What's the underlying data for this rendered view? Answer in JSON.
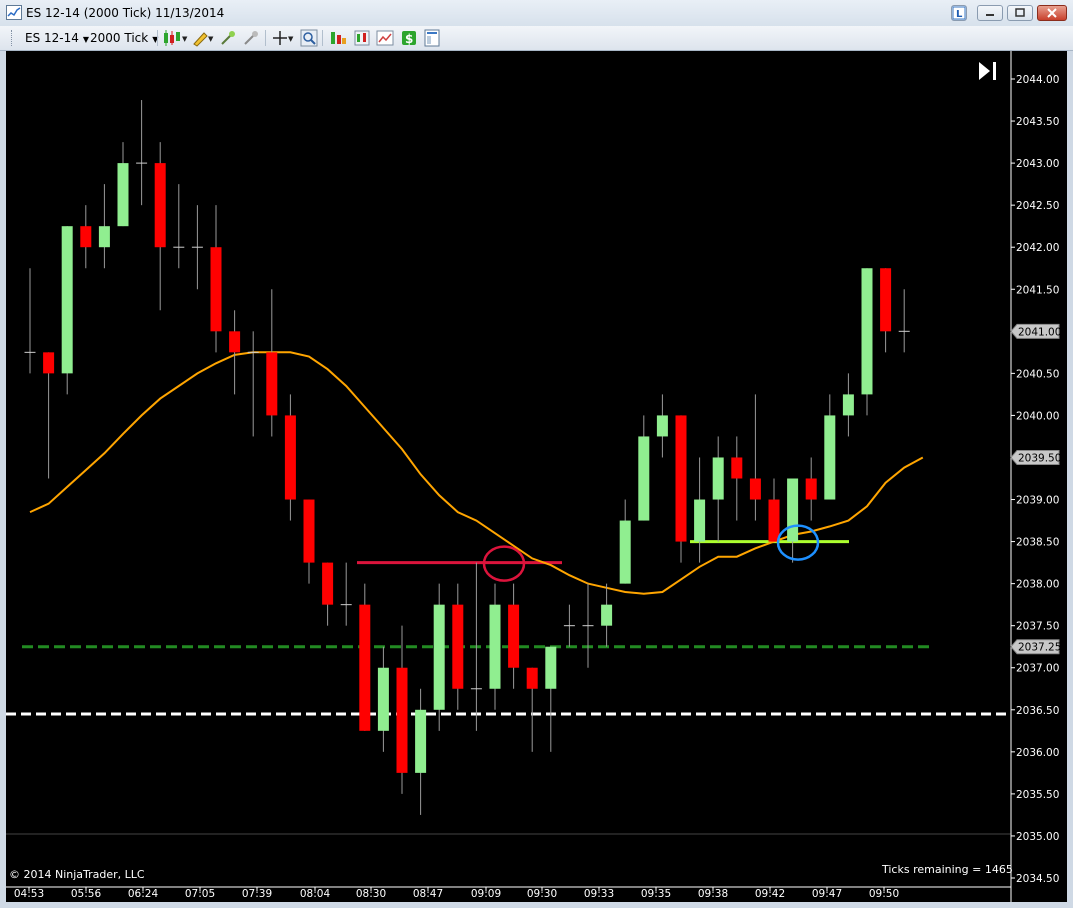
{
  "window": {
    "title": "ES 12-14 (2000 Tick)  11/13/2014",
    "buttons": [
      "L",
      "minimize",
      "maximize",
      "close"
    ]
  },
  "toolbar": {
    "instrument": "ES 12-14",
    "period": "2000 Tick",
    "icons": [
      "candlestick-style-icon",
      "draw-pencil-icon",
      "zoom-in-icon",
      "zoom-out-icon",
      "crosshair-icon",
      "search-zoom-icon",
      "indicators-icon",
      "strategies-icon",
      "market-analyzer-icon",
      "dollar-icon",
      "properties-icon"
    ]
  },
  "chart_data": {
    "type": "candlestick",
    "instrument": "ES 12-14",
    "interval": "2000 Tick",
    "date": "11/13/2014",
    "y_ticks": [
      "2044.00",
      "2043.50",
      "2043.00",
      "2042.50",
      "2042.00",
      "2041.50",
      "2041.00",
      "2040.50",
      "2040.00",
      "2039.50",
      "2039.00",
      "2038.50",
      "2038.00",
      "2037.50",
      "2037.00",
      "2036.50",
      "2036.00",
      "2035.50",
      "2035.00",
      "2034.50"
    ],
    "ylim": [
      2034.5,
      2044.25
    ],
    "x_labels": [
      "04:53",
      "05:56",
      "06:24",
      "07:05",
      "07:39",
      "08:04",
      "08:30",
      "08:47",
      "09:09",
      "09:30",
      "09:33",
      "09:35",
      "09:38",
      "09:42",
      "09:47",
      "09:50"
    ],
    "price_markers": [
      {
        "label": "2041.00",
        "value": 2041.0
      },
      {
        "label": "2039.50",
        "value": 2039.5
      },
      {
        "label": "2037.25",
        "value": 2037.25
      }
    ],
    "candles": [
      {
        "o": 2040.75,
        "h": 2041.75,
        "l": 2040.5,
        "c": 2040.75
      },
      {
        "o": 2040.75,
        "h": 2040.75,
        "l": 2039.25,
        "c": 2040.5
      },
      {
        "o": 2040.5,
        "h": 2042.25,
        "l": 2040.25,
        "c": 2042.25
      },
      {
        "o": 2042.25,
        "h": 2042.5,
        "l": 2041.75,
        "c": 2042.0
      },
      {
        "o": 2042.0,
        "h": 2042.75,
        "l": 2041.75,
        "c": 2042.25
      },
      {
        "o": 2042.25,
        "h": 2043.25,
        "l": 2042.25,
        "c": 2043.0
      },
      {
        "o": 2043.0,
        "h": 2043.75,
        "l": 2042.5,
        "c": 2043.0
      },
      {
        "o": 2043.0,
        "h": 2043.25,
        "l": 2041.25,
        "c": 2042.0
      },
      {
        "o": 2042.0,
        "h": 2042.75,
        "l": 2041.75,
        "c": 2042.0
      },
      {
        "o": 2042.0,
        "h": 2042.5,
        "l": 2041.5,
        "c": 2042.0
      },
      {
        "o": 2042.0,
        "h": 2042.5,
        "l": 2040.75,
        "c": 2041.0
      },
      {
        "o": 2041.0,
        "h": 2041.25,
        "l": 2040.25,
        "c": 2040.75
      },
      {
        "o": 2040.75,
        "h": 2041.0,
        "l": 2039.75,
        "c": 2040.75
      },
      {
        "o": 2040.75,
        "h": 2041.5,
        "l": 2039.75,
        "c": 2040.0
      },
      {
        "o": 2040.0,
        "h": 2040.25,
        "l": 2038.75,
        "c": 2039.0
      },
      {
        "o": 2039.0,
        "h": 2039.0,
        "l": 2038.0,
        "c": 2038.25
      },
      {
        "o": 2038.25,
        "h": 2038.25,
        "l": 2037.5,
        "c": 2037.75
      },
      {
        "o": 2037.75,
        "h": 2038.25,
        "l": 2037.5,
        "c": 2037.75
      },
      {
        "o": 2037.75,
        "h": 2038.0,
        "l": 2036.25,
        "c": 2036.25
      },
      {
        "o": 2036.25,
        "h": 2037.25,
        "l": 2036.0,
        "c": 2037.0
      },
      {
        "o": 2037.0,
        "h": 2037.5,
        "l": 2035.5,
        "c": 2035.75
      },
      {
        "o": 2035.75,
        "h": 2036.75,
        "l": 2035.25,
        "c": 2036.5
      },
      {
        "o": 2036.5,
        "h": 2038.0,
        "l": 2036.25,
        "c": 2037.75
      },
      {
        "o": 2037.75,
        "h": 2038.0,
        "l": 2036.5,
        "c": 2036.75
      },
      {
        "o": 2036.75,
        "h": 2038.25,
        "l": 2036.25,
        "c": 2036.75
      },
      {
        "o": 2036.75,
        "h": 2038.0,
        "l": 2036.5,
        "c": 2037.75
      },
      {
        "o": 2037.75,
        "h": 2038.0,
        "l": 2036.75,
        "c": 2037.0
      },
      {
        "o": 2037.0,
        "h": 2037.0,
        "l": 2036.0,
        "c": 2036.75
      },
      {
        "o": 2036.75,
        "h": 2037.25,
        "l": 2036.0,
        "c": 2037.25
      },
      {
        "o": 2037.5,
        "h": 2037.75,
        "l": 2037.25,
        "c": 2037.5
      },
      {
        "o": 2037.5,
        "h": 2038.0,
        "l": 2037.0,
        "c": 2037.5
      },
      {
        "o": 2037.5,
        "h": 2038.0,
        "l": 2037.25,
        "c": 2037.75
      },
      {
        "o": 2038.0,
        "h": 2039.0,
        "l": 2038.0,
        "c": 2038.75
      },
      {
        "o": 2038.75,
        "h": 2040.0,
        "l": 2038.75,
        "c": 2039.75
      },
      {
        "o": 2039.75,
        "h": 2040.25,
        "l": 2039.5,
        "c": 2040.0
      },
      {
        "o": 2040.0,
        "h": 2040.0,
        "l": 2038.25,
        "c": 2038.5
      },
      {
        "o": 2038.5,
        "h": 2039.5,
        "l": 2038.25,
        "c": 2039.0
      },
      {
        "o": 2039.0,
        "h": 2039.75,
        "l": 2038.5,
        "c": 2039.5
      },
      {
        "o": 2039.5,
        "h": 2039.75,
        "l": 2038.75,
        "c": 2039.25
      },
      {
        "o": 2039.25,
        "h": 2040.25,
        "l": 2038.75,
        "c": 2039.0
      },
      {
        "o": 2039.0,
        "h": 2039.25,
        "l": 2038.5,
        "c": 2038.5
      },
      {
        "o": 2038.5,
        "h": 2039.25,
        "l": 2038.25,
        "c": 2039.25
      },
      {
        "o": 2039.25,
        "h": 2039.5,
        "l": 2038.75,
        "c": 2039.0
      },
      {
        "o": 2039.0,
        "h": 2040.25,
        "l": 2039.0,
        "c": 2040.0
      },
      {
        "o": 2040.0,
        "h": 2040.5,
        "l": 2039.75,
        "c": 2040.25
      },
      {
        "o": 2040.25,
        "h": 2041.75,
        "l": 2040.0,
        "c": 2041.75
      },
      {
        "o": 2041.75,
        "h": 2041.75,
        "l": 2040.75,
        "c": 2041.0
      },
      {
        "o": 2041.0,
        "h": 2041.5,
        "l": 2040.75,
        "c": 2041.0
      }
    ],
    "moving_average": [
      2038.85,
      2038.95,
      2039.15,
      2039.35,
      2039.55,
      2039.78,
      2040.0,
      2040.2,
      2040.35,
      2040.5,
      2040.62,
      2040.72,
      2040.75,
      2040.75,
      2040.75,
      2040.7,
      2040.55,
      2040.35,
      2040.1,
      2039.85,
      2039.6,
      2039.3,
      2039.05,
      2038.85,
      2038.75,
      2038.6,
      2038.45,
      2038.3,
      2038.22,
      2038.1,
      2038.0,
      2037.95,
      2037.9,
      2037.88,
      2037.9,
      2038.05,
      2038.2,
      2038.32,
      2038.32,
      2038.42,
      2038.5,
      2038.58,
      2038.62,
      2038.68,
      2038.75,
      2038.92,
      2039.2,
      2039.38,
      2039.5
    ],
    "annotations": {
      "red_line": 2038.25,
      "green_dashed_line": 2037.25,
      "white_dashed_line": 2036.45,
      "lime_line": 2038.5,
      "red_circle_price": 2038.25,
      "blue_circle_price": 2038.5
    },
    "colors": {
      "up": "#90ee90",
      "down": "#ff0000",
      "moving_average": "#ffa500",
      "red_line": "#dc143c",
      "green_dashed": "#228b22",
      "lime_line": "#adff2f",
      "blue_circle": "#1e90ff",
      "background": "#000000"
    },
    "copyright": "© 2014 NinjaTrader, LLC",
    "ticks_remaining": "Ticks remaining = 1465"
  }
}
